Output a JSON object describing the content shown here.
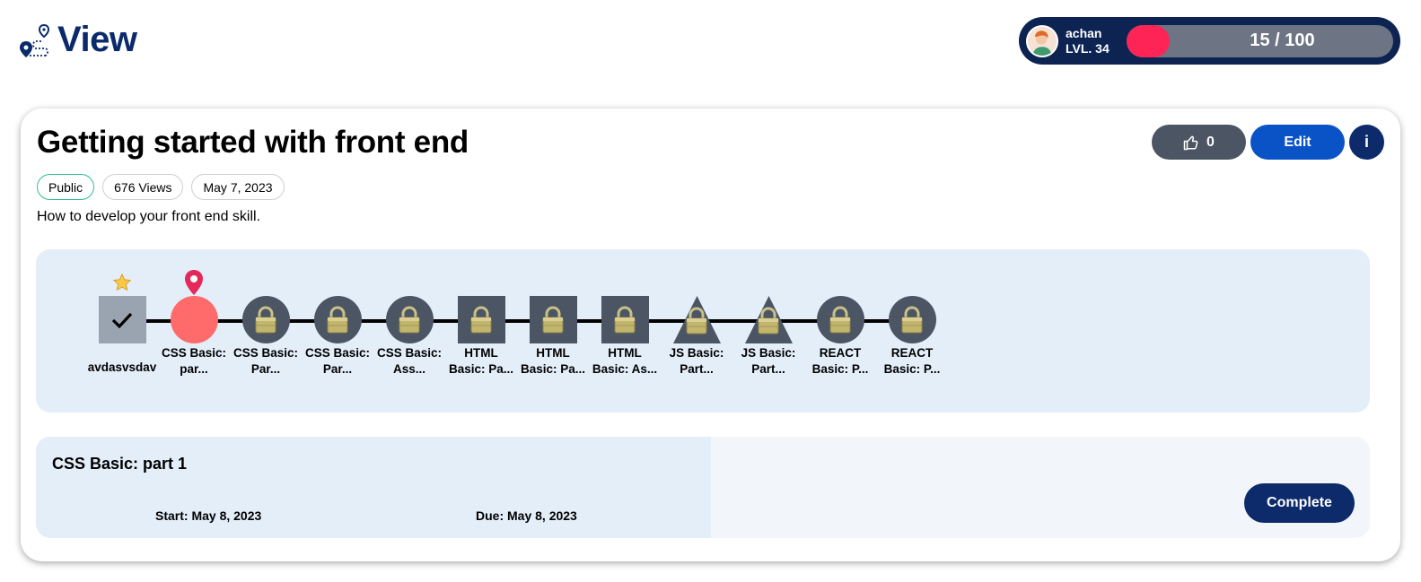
{
  "header": {
    "logo_text": "View",
    "user": {
      "name": "achan",
      "level": "LVL. 34",
      "xp_text": "15 / 100",
      "xp_fraction": 0.15
    }
  },
  "roadmap_page": {
    "title": "Getting started with front end",
    "tags": {
      "visibility": "Public",
      "views": "676 Views",
      "date": "May 7, 2023"
    },
    "description": "How to develop your front end skill.",
    "actions": {
      "likes": "0",
      "edit_label": "Edit",
      "info_label": "i"
    }
  },
  "nodes": [
    {
      "label": "avdasvsdav",
      "shape": "square",
      "status": "done",
      "badge": "star"
    },
    {
      "label": "CSS Basic: par...",
      "shape": "circle",
      "status": "current",
      "badge": "pin"
    },
    {
      "label": "CSS Basic: Par...",
      "shape": "circle",
      "status": "locked"
    },
    {
      "label": "CSS Basic: Par...",
      "shape": "circle",
      "status": "locked"
    },
    {
      "label": "CSS Basic: Ass...",
      "shape": "circle",
      "status": "locked"
    },
    {
      "label": "HTML Basic: Pa...",
      "shape": "square",
      "status": "locked"
    },
    {
      "label": "HTML Basic: Pa...",
      "shape": "square",
      "status": "locked"
    },
    {
      "label": "HTML Basic: As...",
      "shape": "square",
      "status": "locked"
    },
    {
      "label": "JS Basic: Part...",
      "shape": "triangle",
      "status": "locked"
    },
    {
      "label": "JS Basic: Part...",
      "shape": "triangle",
      "status": "locked"
    },
    {
      "label": "REACT Basic: P...",
      "shape": "circle",
      "status": "locked"
    },
    {
      "label": "REACT Basic: P...",
      "shape": "circle",
      "status": "locked"
    }
  ],
  "detail": {
    "title": "CSS Basic: part 1",
    "start": "Start: May 8, 2023",
    "due": "Due: May 8, 2023",
    "complete_label": "Complete"
  },
  "colors": {
    "brand_navy": "#0d2a6b",
    "accent_blue": "#0a53c7",
    "xp_red": "#ff2456",
    "current_node": "#ff6b6b",
    "locked_node": "#4b5563"
  }
}
